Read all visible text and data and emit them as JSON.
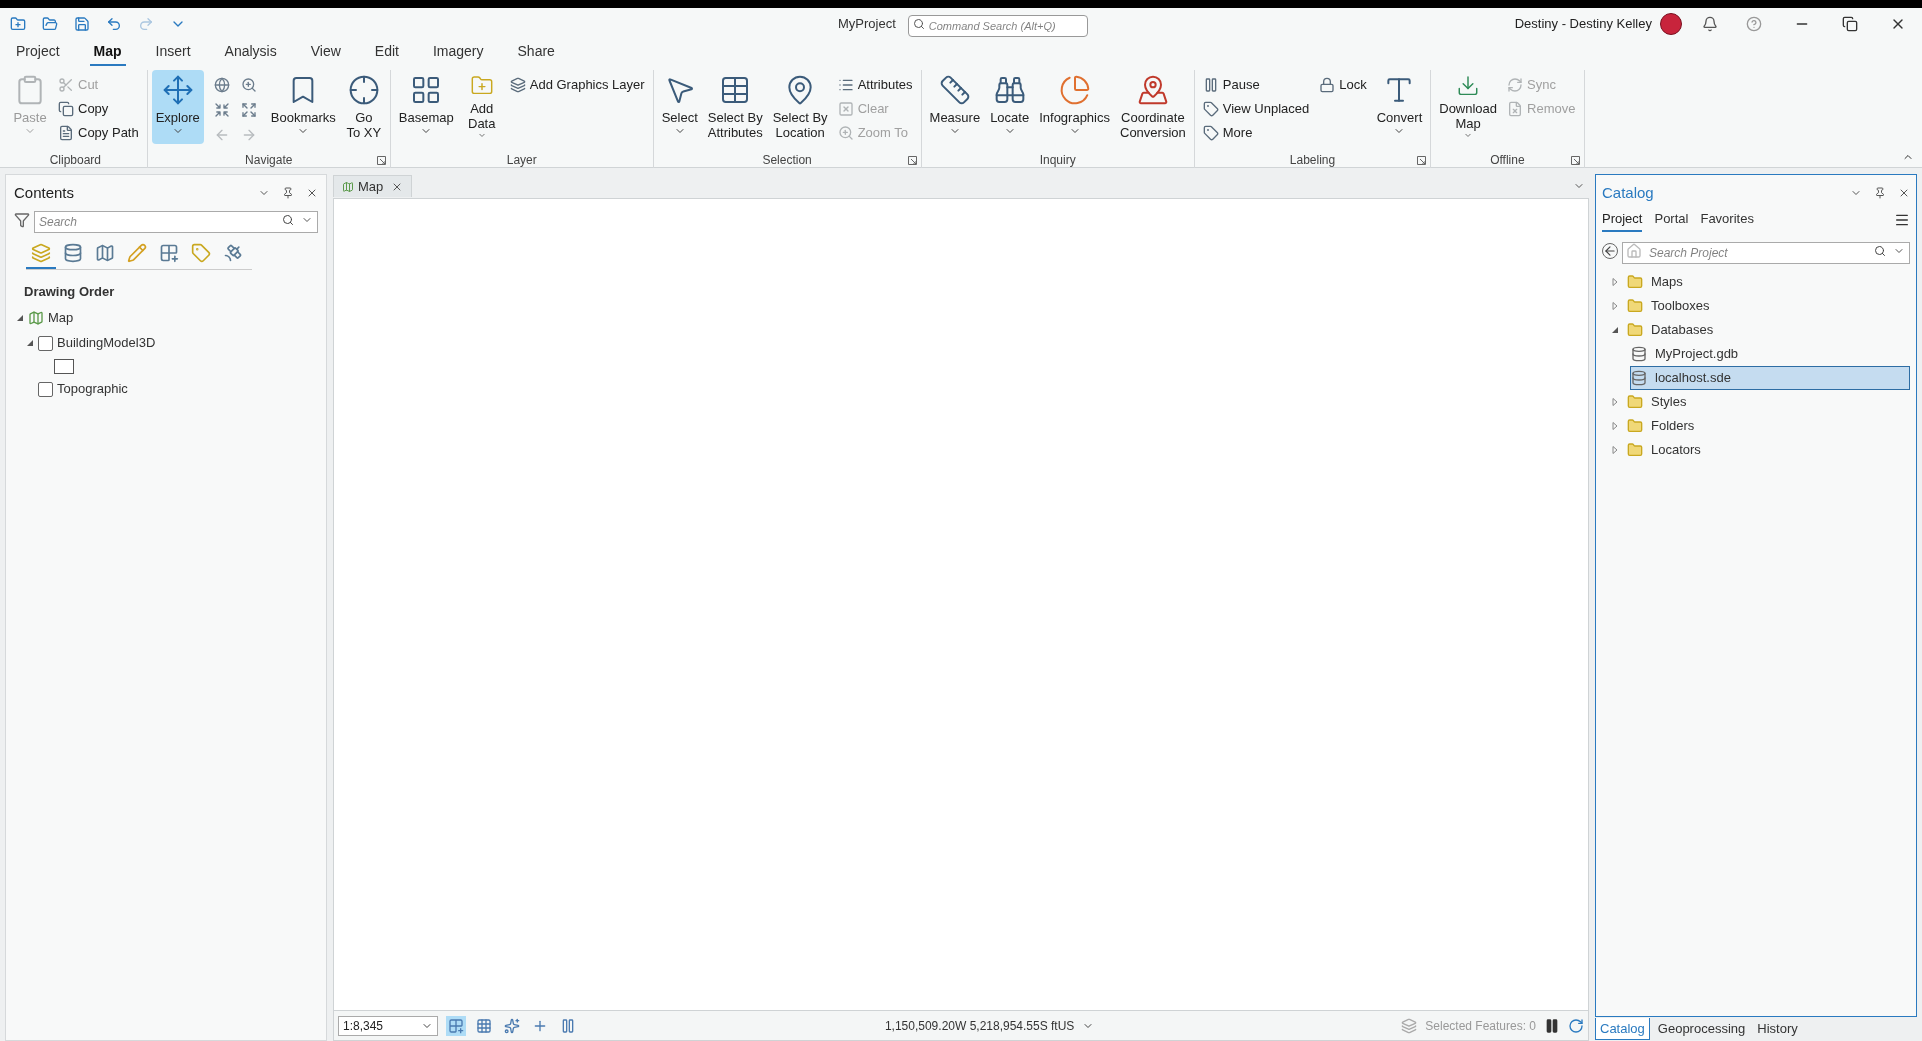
{
  "window": {
    "title": "MyProject",
    "command_search": {
      "placeholder": "Command Search (Alt+Q)"
    },
    "user": "Destiny - Destiny Kelley"
  },
  "ribbon_tabs": [
    {
      "label": "Project",
      "selected": false
    },
    {
      "label": "Map",
      "selected": true
    },
    {
      "label": "Insert",
      "selected": false
    },
    {
      "label": "Analysis",
      "selected": false
    },
    {
      "label": "View",
      "selected": false
    },
    {
      "label": "Edit",
      "selected": false
    },
    {
      "label": "Imagery",
      "selected": false
    },
    {
      "label": "Share",
      "selected": false
    }
  ],
  "ribbon_groups": [
    {
      "label": "Clipboard",
      "launcher": false,
      "items": [
        {
          "kind": "large",
          "lines": [
            "Paste"
          ],
          "disabled": true,
          "dropdown": true,
          "selected": false
        },
        {
          "kind": "stack",
          "items": [
            {
              "label": "Cut",
              "disabled": true
            },
            {
              "label": "Copy",
              "disabled": false
            },
            {
              "label": "Copy Path",
              "disabled": false
            }
          ]
        }
      ]
    },
    {
      "label": "Navigate",
      "launcher": true,
      "items": [
        {
          "kind": "large",
          "lines": [
            "Explore"
          ],
          "disabled": false,
          "dropdown": true,
          "selected": true
        },
        {
          "kind": "icon_grid"
        },
        {
          "kind": "large",
          "lines": [
            "Bookmarks"
          ],
          "disabled": false,
          "dropdown": true,
          "selected": false
        },
        {
          "kind": "large",
          "lines": [
            "Go",
            "To XY"
          ],
          "disabled": false,
          "dropdown": false,
          "selected": false
        }
      ]
    },
    {
      "label": "Layer",
      "launcher": false,
      "items": [
        {
          "kind": "large",
          "lines": [
            "Basemap"
          ],
          "disabled": false,
          "dropdown": true,
          "selected": false
        },
        {
          "kind": "large",
          "lines": [
            "Add",
            "Data"
          ],
          "disabled": false,
          "dropdown": true,
          "selected": false
        },
        {
          "kind": "stack",
          "items": [
            {
              "label": "Add Graphics Layer",
              "disabled": false
            }
          ]
        }
      ]
    },
    {
      "label": "Selection",
      "launcher": true,
      "items": [
        {
          "kind": "large",
          "lines": [
            "Select"
          ],
          "disabled": false,
          "dropdown": true,
          "selected": false
        },
        {
          "kind": "large",
          "lines": [
            "Select By",
            "Attributes"
          ],
          "disabled": false,
          "dropdown": false,
          "selected": false
        },
        {
          "kind": "large",
          "lines": [
            "Select By",
            "Location"
          ],
          "disabled": false,
          "dropdown": false,
          "selected": false
        },
        {
          "kind": "stack",
          "items": [
            {
              "label": "Attributes",
              "disabled": false
            },
            {
              "label": "Clear",
              "disabled": true
            },
            {
              "label": "Zoom To",
              "disabled": true
            }
          ]
        }
      ]
    },
    {
      "label": "Inquiry",
      "launcher": false,
      "items": [
        {
          "kind": "large",
          "lines": [
            "Measure"
          ],
          "disabled": false,
          "dropdown": true,
          "selected": false
        },
        {
          "kind": "large",
          "lines": [
            "Locate"
          ],
          "disabled": false,
          "dropdown": true,
          "selected": false
        },
        {
          "kind": "large",
          "lines": [
            "Infographics"
          ],
          "disabled": false,
          "dropdown": true,
          "selected": false
        },
        {
          "kind": "large",
          "lines": [
            "Coordinate",
            "Conversion"
          ],
          "disabled": false,
          "dropdown": false,
          "selected": false
        }
      ]
    },
    {
      "label": "Labeling",
      "launcher": true,
      "items": [
        {
          "kind": "stack",
          "items": [
            {
              "label": "Pause",
              "disabled": false
            },
            {
              "label": "View Unplaced",
              "disabled": false
            },
            {
              "label": "More",
              "disabled": false
            }
          ]
        },
        {
          "kind": "stack",
          "items": [
            {
              "label": "Lock",
              "disabled": false
            }
          ]
        },
        {
          "kind": "large",
          "lines": [
            "Convert"
          ],
          "disabled": false,
          "dropdown": true,
          "selected": false
        }
      ]
    },
    {
      "label": "Offline",
      "launcher": true,
      "items": [
        {
          "kind": "large",
          "lines": [
            "Download",
            "Map"
          ],
          "disabled": false,
          "dropdown": true,
          "selected": false
        },
        {
          "kind": "stack",
          "items": [
            {
              "label": "Sync",
              "disabled": true
            },
            {
              "label": "Remove",
              "disabled": true
            }
          ]
        }
      ]
    }
  ],
  "contents": {
    "title": "Contents",
    "search": {
      "placeholder": "Search"
    },
    "view_tabs": [
      {
        "selected": true
      },
      {
        "selected": false
      },
      {
        "selected": false
      },
      {
        "selected": false
      },
      {
        "selected": false
      },
      {
        "selected": false
      },
      {
        "selected": false
      }
    ],
    "heading": "Drawing Order",
    "tree": [
      {
        "label": "Map",
        "kind": "map",
        "expanded": true,
        "children": [
          {
            "label": "BuildingModel3D",
            "kind": "layer",
            "checked": false,
            "expanded": true,
            "children": [
              {
                "kind": "symbol"
              }
            ]
          },
          {
            "label": "Topographic",
            "kind": "layer",
            "checked": false
          }
        ]
      }
    ]
  },
  "map_view": {
    "tab": "Map",
    "scale": "1:8,345",
    "coordinates": "1,150,509.20W 5,218,954.55S ftUS",
    "selected_features": "Selected Features: 0"
  },
  "catalog": {
    "title": "Catalog",
    "tabs": [
      {
        "label": "Project",
        "selected": true
      },
      {
        "label": "Portal",
        "selected": false
      },
      {
        "label": "Favorites",
        "selected": false
      }
    ],
    "search": {
      "placeholder": "Search Project"
    },
    "tree": [
      {
        "label": "Maps",
        "expanded": false,
        "selected": false
      },
      {
        "label": "Toolboxes",
        "expanded": false,
        "selected": false
      },
      {
        "label": "Databases",
        "expanded": true,
        "selected": false,
        "children": [
          {
            "label": "MyProject.gdb",
            "selected": false
          },
          {
            "label": "localhost.sde",
            "selected": true
          }
        ]
      },
      {
        "label": "Styles",
        "expanded": false,
        "selected": false
      },
      {
        "label": "Folders",
        "expanded": false,
        "selected": false
      },
      {
        "label": "Locators",
        "expanded": false,
        "selected": false
      }
    ]
  },
  "bottom_tabs": [
    {
      "label": "Catalog",
      "selected": true
    },
    {
      "label": "Geoprocessing",
      "selected": false
    },
    {
      "label": "History",
      "selected": false
    }
  ]
}
